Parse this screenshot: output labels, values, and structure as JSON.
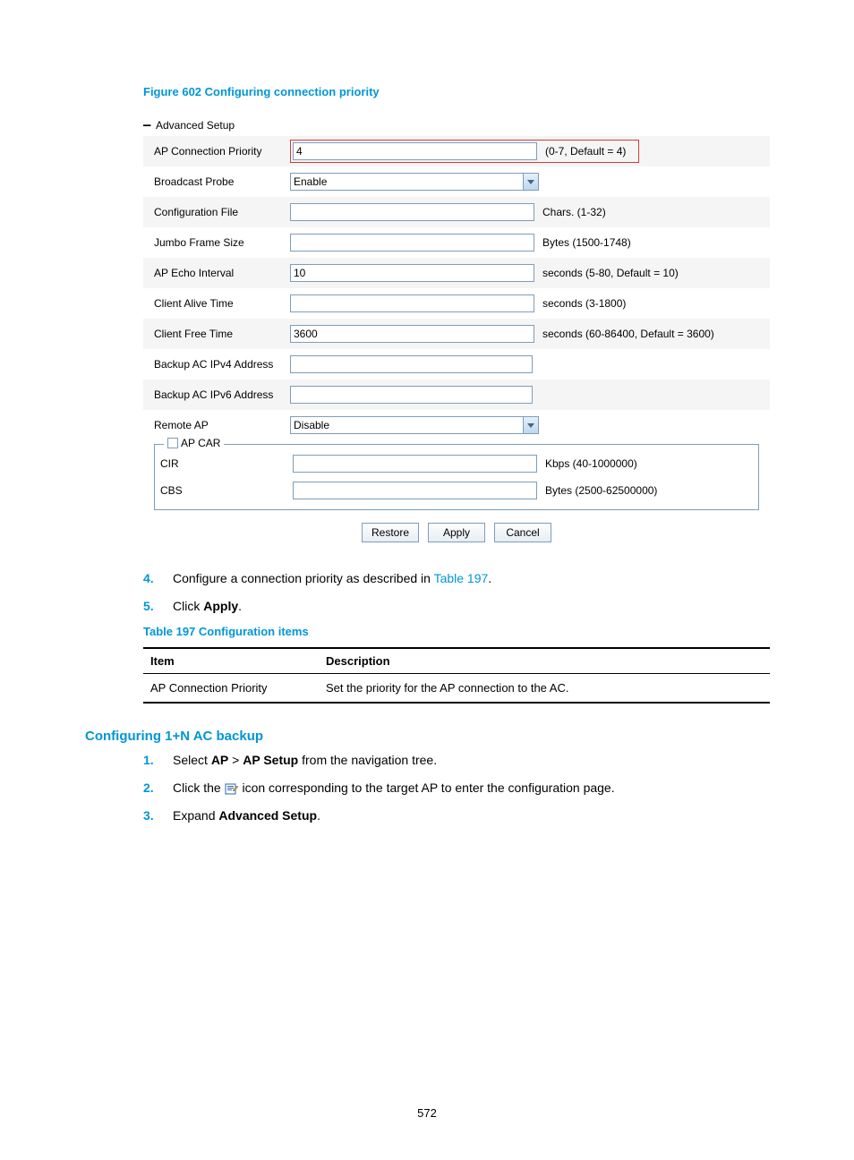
{
  "figure": {
    "label": "Figure 602 Configuring connection priority"
  },
  "panel": {
    "section_header": "Advanced Setup",
    "rows": {
      "ap_conn_priority": {
        "label": "AP Connection Priority",
        "value": "4",
        "hint": "(0-7, Default = 4)"
      },
      "broadcast_probe": {
        "label": "Broadcast Probe",
        "value": "Enable"
      },
      "config_file": {
        "label": "Configuration File",
        "value": "",
        "hint": "Chars. (1-32)"
      },
      "jumbo_frame": {
        "label": "Jumbo Frame Size",
        "value": "",
        "hint": "Bytes (1500-1748)"
      },
      "ap_echo": {
        "label": "AP Echo Interval",
        "value": "10",
        "hint": "seconds (5-80, Default = 10)"
      },
      "client_alive": {
        "label": "Client Alive Time",
        "value": "",
        "hint": "seconds (3-1800)"
      },
      "client_free": {
        "label": "Client Free Time",
        "value": "3600",
        "hint": "seconds (60-86400, Default = 3600)"
      },
      "bkup_ipv4": {
        "label": "Backup AC IPv4 Address",
        "value": ""
      },
      "bkup_ipv6": {
        "label": "Backup AC IPv6 Address",
        "value": ""
      },
      "remote_ap": {
        "label": "Remote AP",
        "value": "Disable"
      }
    },
    "fieldset": {
      "legend": "AP CAR",
      "cir": {
        "label": "CIR",
        "value": "",
        "hint": "Kbps (40-1000000)"
      },
      "cbs": {
        "label": "CBS",
        "value": "",
        "hint": "Bytes (2500-62500000)"
      }
    },
    "buttons": {
      "restore": "Restore",
      "apply": "Apply",
      "cancel": "Cancel"
    }
  },
  "steps_a": {
    "s4_pre": "Configure a connection priority as described in ",
    "s4_link": "Table 197",
    "s4_post": ".",
    "s5_pre": "Click ",
    "s5_bold": "Apply",
    "s5_post": "."
  },
  "table": {
    "title": "Table 197 Configuration items",
    "headers": {
      "item": "Item",
      "desc": "Description"
    },
    "row": {
      "item": "AP Connection Priority",
      "desc": "Set the priority for the AP connection to the AC."
    }
  },
  "section_b": {
    "heading": "Configuring 1+N AC backup",
    "s1_pre": "Select ",
    "s1_b1": "AP",
    "s1_mid": " > ",
    "s1_b2": "AP Setup",
    "s1_post": " from the navigation tree.",
    "s2_pre": "Click the ",
    "s2_post": " icon corresponding to the target AP to enter the configuration page.",
    "s3_pre": "Expand ",
    "s3_bold": "Advanced Setup",
    "s3_post": "."
  },
  "page_number": "572"
}
